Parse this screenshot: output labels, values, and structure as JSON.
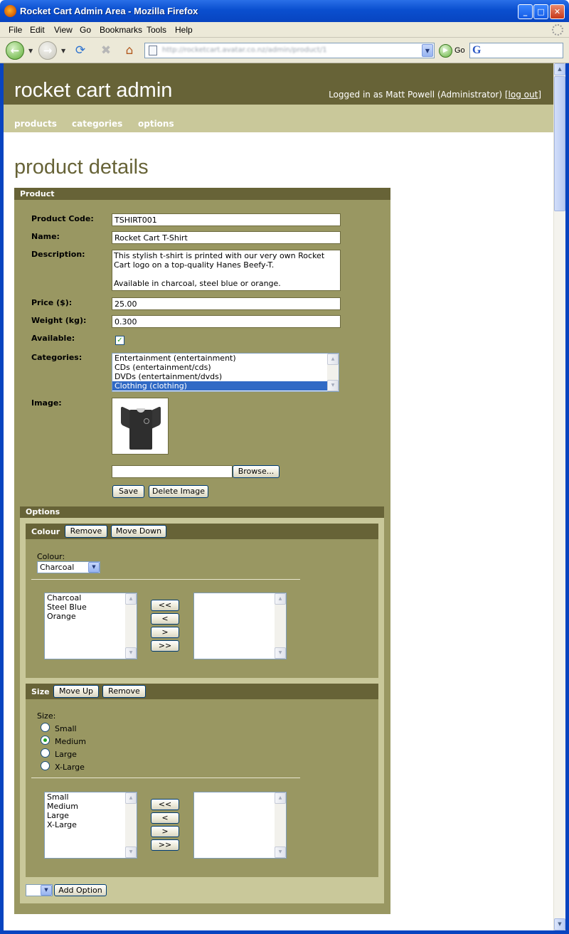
{
  "browser": {
    "title": "Rocket Cart Admin Area - Mozilla Firefox",
    "menu": [
      "File",
      "Edit",
      "View",
      "Go",
      "Bookmarks",
      "Tools",
      "Help"
    ],
    "url": "http://rocketcart.avatar.co.nz/admin/product/1",
    "go_label": "Go"
  },
  "header": {
    "site_title": "rocket cart admin",
    "login_text": "Logged in as Matt Powell (Administrator) [",
    "logout_label": "log out",
    "login_close": "]"
  },
  "nav": {
    "items": [
      "products",
      "categories",
      "options"
    ]
  },
  "page_title": "product details",
  "product": {
    "panel_title": "Product",
    "code_label": "Product Code:",
    "code": "TSHIRT001",
    "name_label": "Name:",
    "name": "Rocket Cart T-Shirt",
    "description_label": "Description:",
    "description_lines": [
      "This stylish t-shirt is printed with our very own Rocket",
      "Cart logo on a top-quality Hanes Beefy-T.",
      "",
      "Available in charcoal, steel blue or orange."
    ],
    "price_label": "Price ($):",
    "price": "25.00",
    "weight_label": "Weight (kg):",
    "weight": "0.300",
    "available_label": "Available:",
    "available": true,
    "categories_label": "Categories:",
    "categories": [
      "Entertainment (entertainment)",
      "CDs (entertainment/cds)",
      "DVDs (entertainment/dvds)",
      "Clothing (clothing)"
    ],
    "categories_selected": "Clothing (clothing)",
    "image_label": "Image:",
    "browse_label": "Browse...",
    "save_label": "Save",
    "delete_image_label": "Delete Image"
  },
  "options": {
    "panel_title": "Options",
    "colour": {
      "name": "Colour",
      "remove_label": "Remove",
      "move_down_label": "Move Down",
      "field_label": "Colour:",
      "selected": "Charcoal",
      "values": [
        "Charcoal",
        "Steel Blue",
        "Orange"
      ]
    },
    "size": {
      "name": "Size",
      "move_up_label": "Move Up",
      "remove_label": "Remove",
      "field_label": "Size:",
      "choices": [
        "Small",
        "Medium",
        "Large",
        "X-Large"
      ],
      "selected": "Medium",
      "values": [
        "Small",
        "Medium",
        "Large",
        "X-Large"
      ]
    },
    "transfer_buttons": [
      "<<",
      "<",
      ">",
      ">>"
    ],
    "add_option_label": "Add Option"
  }
}
